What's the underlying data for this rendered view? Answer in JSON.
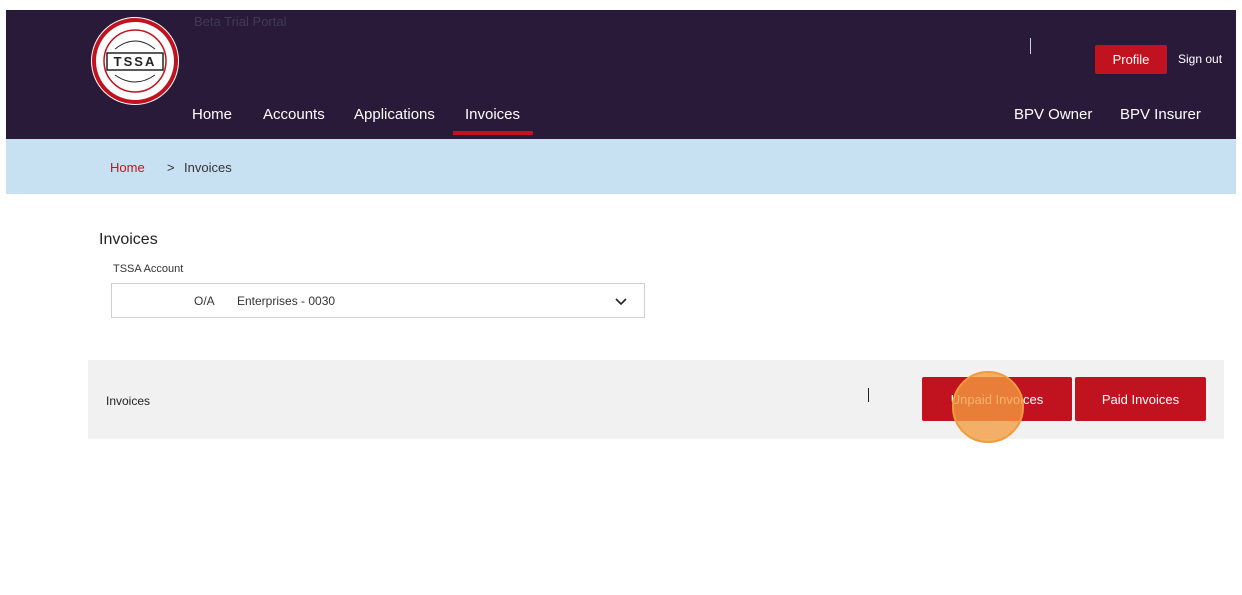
{
  "header": {
    "portal_label": "Beta Trial Portal",
    "logo": {
      "text": "TSSA",
      "ring_text": "TECHNICAL STANDARDS & SAFETY AUTHORITY"
    },
    "nav": [
      "Home",
      "Accounts",
      "Applications",
      "Invoices"
    ],
    "active_nav": "Invoices",
    "right_nav": [
      "BPV Owner",
      "BPV Insurer"
    ],
    "separator": "|",
    "profile_label": "Profile",
    "signout_label": "Sign out"
  },
  "breadcrumb": {
    "home": "Home",
    "separator": ">",
    "current": "Invoices"
  },
  "main": {
    "title": "Invoices",
    "account_label": "TSSA Account",
    "account_select": {
      "prefix": "O/A",
      "value": "Enterprises - 0030"
    },
    "panel": {
      "label": "Invoices",
      "unpaid_label": "Unpaid Invoices",
      "paid_label": "Paid Invoices"
    }
  },
  "colors": {
    "header_bg": "#2a1a3a",
    "accent_red": "#c1121f",
    "breadcrumb_bg": "#c7e1f3",
    "panel_bg": "#f1f1f1",
    "click_highlight": "#f29b3c"
  }
}
